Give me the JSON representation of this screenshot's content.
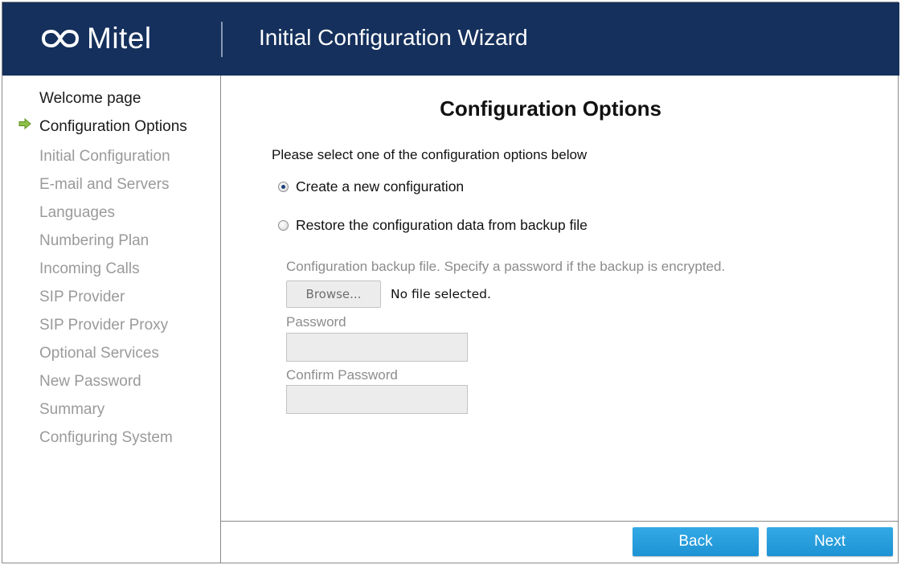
{
  "header": {
    "brand": "Mitel",
    "title": "Initial Configuration Wizard",
    "colors": {
      "header_bg": "#15305c",
      "text": "#ffffff"
    }
  },
  "sidebar": {
    "current_indicator_icon": "arrow-right-icon",
    "items": [
      {
        "label": "Welcome page",
        "state": "done"
      },
      {
        "label": "Configuration Options",
        "state": "current"
      },
      {
        "label": "Initial Configuration",
        "state": "pending"
      },
      {
        "label": "E-mail and Servers",
        "state": "pending"
      },
      {
        "label": "Languages",
        "state": "pending"
      },
      {
        "label": "Numbering Plan",
        "state": "pending"
      },
      {
        "label": "Incoming Calls",
        "state": "pending"
      },
      {
        "label": "SIP Provider",
        "state": "pending"
      },
      {
        "label": "SIP Provider Proxy",
        "state": "pending"
      },
      {
        "label": "Optional Services",
        "state": "pending"
      },
      {
        "label": "New Password",
        "state": "pending"
      },
      {
        "label": "Summary",
        "state": "pending"
      },
      {
        "label": "Configuring System",
        "state": "pending"
      }
    ]
  },
  "main": {
    "title": "Configuration Options",
    "instruction": "Please select one of the configuration options below",
    "options": [
      {
        "label": "Create a new configuration",
        "checked": true
      },
      {
        "label": "Restore the configuration data from backup file",
        "checked": false
      }
    ],
    "backup": {
      "description": "Configuration backup file. Specify a password if the backup is encrypted.",
      "browse_label": "Browse...",
      "file_status": "No file selected.",
      "password_label": "Password",
      "password_value": "",
      "confirm_label": "Confirm Password",
      "confirm_value": ""
    }
  },
  "footer": {
    "back_label": "Back",
    "next_label": "Next",
    "button_color": "#22a0de"
  }
}
